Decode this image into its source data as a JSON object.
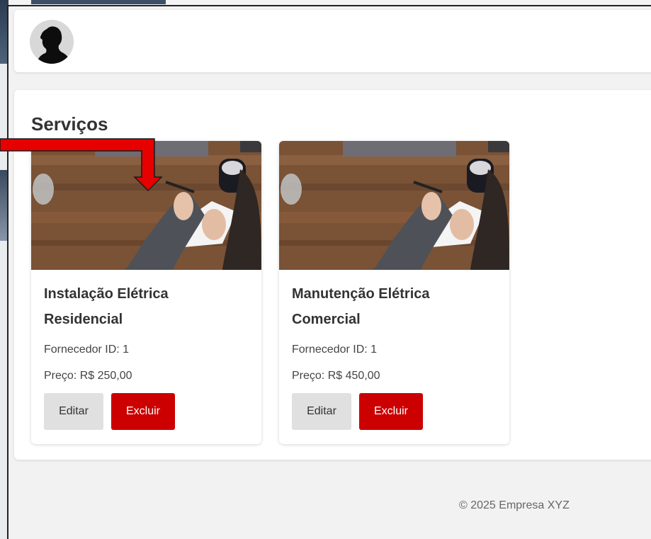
{
  "section": {
    "title": "Serviços"
  },
  "services": [
    {
      "title": "Instalação Elétrica Residencial",
      "supplier": "Fornecedor ID: 1",
      "price": "Preço: R$ 250,00",
      "edit_label": "Editar",
      "delete_label": "Excluir"
    },
    {
      "title": "Manutenção Elétrica Comercial",
      "supplier": "Fornecedor ID: 1",
      "price": "Preço: R$ 450,00",
      "edit_label": "Editar",
      "delete_label": "Excluir"
    }
  ],
  "footer": {
    "copyright": "© 2025 Empresa XYZ"
  },
  "colors": {
    "delete_button": "#cc0000",
    "edit_button": "#e0e0e0",
    "annotation_arrow": "#e60000"
  },
  "icons": {
    "avatar": "user-silhouette-icon",
    "annotation": "red-arrow-pointer"
  }
}
